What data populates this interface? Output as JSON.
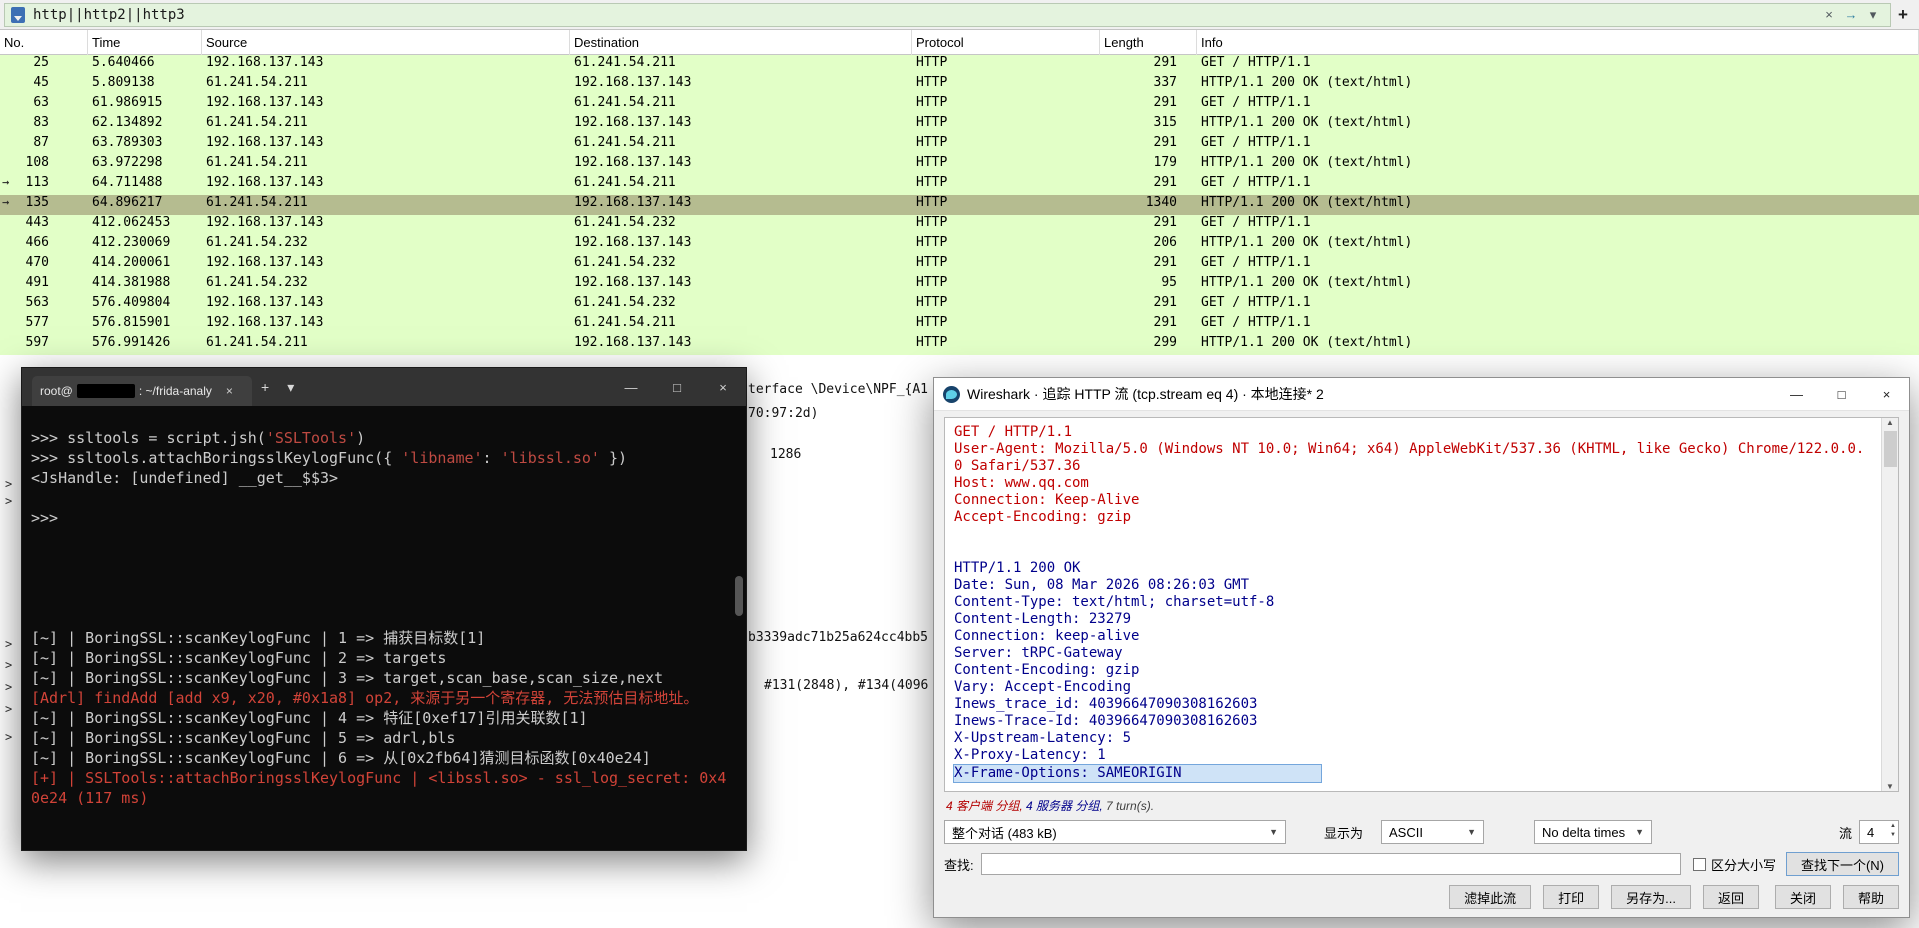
{
  "filter_bar": {
    "value": "http||http2||http3",
    "clear_icon": "×",
    "apply_icon": "→",
    "history_icon": "▾",
    "add_icon": "+"
  },
  "packet_list": {
    "columns": [
      "No.",
      "Time",
      "Source",
      "Destination",
      "Protocol",
      "Length",
      "Info"
    ],
    "rows": [
      {
        "no": "25",
        "time": "5.640466",
        "source": "192.168.137.143",
        "destination": "61.241.54.211",
        "protocol": "HTTP",
        "length": "291",
        "info": "GET / HTTP/1.1"
      },
      {
        "no": "45",
        "time": "5.809138",
        "source": "61.241.54.211",
        "destination": "192.168.137.143",
        "protocol": "HTTP",
        "length": "337",
        "info": "HTTP/1.1 200 OK  (text/html)"
      },
      {
        "no": "63",
        "time": "61.986915",
        "source": "192.168.137.143",
        "destination": "61.241.54.211",
        "protocol": "HTTP",
        "length": "291",
        "info": "GET / HTTP/1.1"
      },
      {
        "no": "83",
        "time": "62.134892",
        "source": "61.241.54.211",
        "destination": "192.168.137.143",
        "protocol": "HTTP",
        "length": "315",
        "info": "HTTP/1.1 200 OK  (text/html)"
      },
      {
        "no": "87",
        "time": "63.789303",
        "source": "192.168.137.143",
        "destination": "61.241.54.211",
        "protocol": "HTTP",
        "length": "291",
        "info": "GET / HTTP/1.1"
      },
      {
        "no": "108",
        "time": "63.972298",
        "source": "61.241.54.211",
        "destination": "192.168.137.143",
        "protocol": "HTTP",
        "length": "179",
        "info": "HTTP/1.1 200 OK  (text/html)"
      },
      {
        "no": "113",
        "time": "64.711488",
        "source": "192.168.137.143",
        "destination": "61.241.54.211",
        "protocol": "HTTP",
        "length": "291",
        "info": "GET / HTTP/1.1",
        "marker": "→"
      },
      {
        "no": "135",
        "time": "64.896217",
        "source": "61.241.54.211",
        "destination": "192.168.137.143",
        "protocol": "HTTP",
        "length": "1340",
        "info": "HTTP/1.1 200 OK  (text/html)",
        "marker": "→",
        "class": "selected"
      },
      {
        "no": "443",
        "time": "412.062453",
        "source": "192.168.137.143",
        "destination": "61.241.54.232",
        "protocol": "HTTP",
        "length": "291",
        "info": "GET / HTTP/1.1"
      },
      {
        "no": "466",
        "time": "412.230069",
        "source": "61.241.54.232",
        "destination": "192.168.137.143",
        "protocol": "HTTP",
        "length": "206",
        "info": "HTTP/1.1 200 OK  (text/html)"
      },
      {
        "no": "470",
        "time": "414.200061",
        "source": "192.168.137.143",
        "destination": "61.241.54.232",
        "protocol": "HTTP",
        "length": "291",
        "info": "GET / HTTP/1.1"
      },
      {
        "no": "491",
        "time": "414.381988",
        "source": "61.241.54.232",
        "destination": "192.168.137.143",
        "protocol": "HTTP",
        "length": "95",
        "info": "HTTP/1.1 200 OK  (text/html)"
      },
      {
        "no": "563",
        "time": "576.409804",
        "source": "192.168.137.143",
        "destination": "61.241.54.232",
        "protocol": "HTTP",
        "length": "291",
        "info": "GET / HTTP/1.1"
      },
      {
        "no": "577",
        "time": "576.815901",
        "source": "192.168.137.143",
        "destination": "61.241.54.211",
        "protocol": "HTTP",
        "length": "291",
        "info": "GET / HTTP/1.1"
      },
      {
        "no": "597",
        "time": "576.991426",
        "source": "61.241.54.211",
        "destination": "192.168.137.143",
        "protocol": "HTTP",
        "length": "299",
        "info": "HTTP/1.1 200 OK  (text/html)"
      }
    ]
  },
  "detail_fragments": {
    "chevron": ">",
    "f1": "terface \\Device\\NPF_{A1",
    "f2": "70:97:2d)",
    "f3": "1286",
    "f4": "b3339adc71b25a624cc4bb5",
    "f5": "#131(2848), #134(4096"
  },
  "terminal": {
    "tab": {
      "user": "root@",
      "path": ": ~/frida-analy",
      "close_icon": "×"
    },
    "new_tab_icon": "+",
    "tab_dropdown_icon": "▾",
    "controls": {
      "minimize": "—",
      "maximize": "□",
      "close": "×"
    },
    "lines": [
      {
        "segs": [
          [
            ">>> ssltools = script.jsh(",
            ""
          ],
          [
            "'SSLTools'",
            "str"
          ],
          [
            ")",
            ""
          ]
        ]
      },
      {
        "segs": [
          [
            ">>> ssltools.attachBoringsslKeylogFunc({ ",
            ""
          ],
          [
            "'libname'",
            "str"
          ],
          [
            ": ",
            ""
          ],
          [
            "'libssl.so'",
            "str"
          ],
          [
            " })",
            ""
          ]
        ]
      },
      {
        "segs": [
          [
            "<JsHandle: [undefined] __get__$$3>",
            ""
          ]
        ]
      },
      {
        "segs": [
          [
            "",
            ""
          ]
        ]
      },
      {
        "segs": [
          [
            ">>>",
            ""
          ]
        ]
      },
      {
        "segs": [
          [
            "",
            ""
          ]
        ]
      },
      {
        "segs": [
          [
            "",
            ""
          ]
        ]
      },
      {
        "segs": [
          [
            "",
            ""
          ]
        ]
      },
      {
        "segs": [
          [
            "",
            ""
          ]
        ]
      },
      {
        "segs": [
          [
            "",
            ""
          ]
        ]
      },
      {
        "segs": [
          [
            "[~] | BoringSSL::scanKeylogFunc | 1 => 捕获目标数[1]",
            ""
          ]
        ]
      },
      {
        "segs": [
          [
            "[~] | BoringSSL::scanKeylogFunc | 2 => targets",
            ""
          ]
        ]
      },
      {
        "segs": [
          [
            "[~] | BoringSSL::scanKeylogFunc | 3 => target,scan_base,scan_size,next",
            ""
          ]
        ]
      },
      {
        "segs": [
          [
            "[Adrl] findAdd [add x9, x20, #0x1a8] op2, 来源于另一个寄存器, 无法预估目标地址。",
            "err"
          ]
        ]
      },
      {
        "segs": [
          [
            "[~] | BoringSSL::scanKeylogFunc | 4 => 特征[0xef17]引用关联数[1]",
            ""
          ]
        ]
      },
      {
        "segs": [
          [
            "[~] | BoringSSL::scanKeylogFunc | 5 => adrl,bls",
            ""
          ]
        ]
      },
      {
        "segs": [
          [
            "[~] | BoringSSL::scanKeylogFunc | 6 => 从[0x2fb64]猜测目标函数[0x40e24]",
            ""
          ]
        ]
      },
      {
        "segs": [
          [
            "[+] | SSLTools::attachBoringsslKeylogFunc | <libssl.so> - ssl_log_secret: 0x40e24 (117 ms)",
            "err"
          ]
        ]
      }
    ]
  },
  "stream": {
    "title": "Wireshark · 追踪 HTTP 流 (tcp.stream eq 4) · 本地连接* 2",
    "controls_icons": {
      "minimize": "—",
      "maximize": "□",
      "close": "×"
    },
    "scroll_up_icon": "▲",
    "scroll_down_icon": "▼",
    "lines": [
      {
        "text": "GET / HTTP/1.1",
        "class": "client"
      },
      {
        "text": "User-Agent: Mozilla/5.0 (Windows NT 10.0; Win64; x64) AppleWebKit/537.36 (KHTML, like Gecko) Chrome/122.0.0.0 Safari/537.36",
        "class": "client"
      },
      {
        "text": "Host: www.qq.com",
        "class": "client"
      },
      {
        "text": "Connection: Keep-Alive",
        "class": "client"
      },
      {
        "text": "Accept-Encoding: gzip",
        "class": "client"
      },
      {
        "text": ""
      },
      {
        "text": ""
      },
      {
        "text": "HTTP/1.1 200 OK",
        "class": "server"
      },
      {
        "text": "Date: Sun, 08 Mar 2026 08:26:03 GMT",
        "class": "server"
      },
      {
        "text": "Content-Type: text/html; charset=utf-8",
        "class": "server"
      },
      {
        "text": "Content-Length: 23279",
        "class": "server"
      },
      {
        "text": "Connection: keep-alive",
        "class": "server"
      },
      {
        "text": "Server: tRPC-Gateway",
        "class": "server"
      },
      {
        "text": "Content-Encoding: gzip",
        "class": "server"
      },
      {
        "text": "Vary: Accept-Encoding",
        "class": "server"
      },
      {
        "text": "Inews_trace_id: 40396647090308162603",
        "class": "server"
      },
      {
        "text": "Inews-Trace-Id: 40396647090308162603",
        "class": "server"
      },
      {
        "text": "X-Upstream-Latency: 5",
        "class": "server"
      },
      {
        "text": "X-Proxy-Latency: 1",
        "class": "server"
      },
      {
        "text": "X-Frame-Options: SAMEORIGIN",
        "class": "server sel"
      }
    ],
    "status": {
      "client": "4 客户端 分组,",
      "server": " 4 服务器 分组,",
      "turns": " 7 turn(s)."
    },
    "controls": {
      "conversation": "整个对话 (483 kB)",
      "show_as_label": "显示为",
      "encoding": "ASCII",
      "delta": "No delta times",
      "stream_label": "流",
      "stream_number": "4",
      "dropdown_icon": "▼",
      "spin_up": "▲",
      "spin_down": "▼"
    },
    "find": {
      "label": "查找:",
      "value": "",
      "case_label": "区分大小写",
      "next_label": "查找下一个(N)"
    },
    "buttons": {
      "filter_out": "滤掉此流",
      "print": "打印",
      "save_as": "另存为...",
      "back": "返回",
      "close": "关闭",
      "help": "帮助"
    }
  }
}
